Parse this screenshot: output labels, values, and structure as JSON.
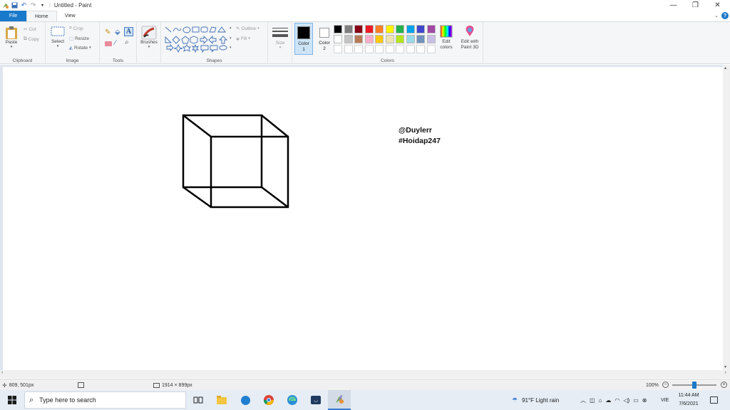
{
  "window": {
    "title": "Untitled - Paint",
    "minimize_glyph": "—",
    "restore_glyph": "❐",
    "close_glyph": "✕"
  },
  "tabs": [
    {
      "label": "File"
    },
    {
      "label": "Home"
    },
    {
      "label": "View"
    }
  ],
  "ribbon": {
    "clipboard": {
      "label": "Clipboard",
      "paste": "Paste",
      "cut": "Cut",
      "copy": "Copy"
    },
    "image": {
      "label": "Image",
      "select": "Select",
      "crop": "Crop",
      "resize": "Resize",
      "rotate": "Rotate"
    },
    "tools": {
      "label": "Tools"
    },
    "brushes": {
      "label": "Brushes"
    },
    "shapes": {
      "label": "Shapes",
      "outline": "Outline",
      "fill": "Fill"
    },
    "size": {
      "label": "Size"
    },
    "colors": {
      "label": "Colors",
      "color1": "Color 1",
      "color2": "Color 2",
      "edit_colors": "Edit colors",
      "edit_paint3d": "Edit with Paint 3D",
      "color1_value": "#000000",
      "color2_value": "#ffffff",
      "palette_row1": [
        "#000000",
        "#7f7f7f",
        "#880015",
        "#ed1c24",
        "#ff7f27",
        "#fff200",
        "#22b14c",
        "#00a2e8",
        "#3f48cc",
        "#a349a4"
      ],
      "palette_row2": [
        "#ffffff",
        "#c3c3c3",
        "#b97a57",
        "#ffaec9",
        "#ffc90e",
        "#efe4b0",
        "#b5e61d",
        "#99d9ea",
        "#7092be",
        "#c8bfe7"
      ],
      "palette_row3": [
        "#ffffff",
        "#ffffff",
        "#ffffff",
        "#ffffff",
        "#ffffff",
        "#ffffff",
        "#ffffff",
        "#ffffff",
        "#ffffff",
        "#ffffff"
      ]
    }
  },
  "canvas": {
    "watermark_line1": "@Duylerr",
    "watermark_line2": "#Hoidap247"
  },
  "statusbar": {
    "cursor_position": "809, 501px",
    "canvas_size": "1914 × 899px",
    "zoom": "100%",
    "zoom_level": 1.0
  },
  "taskbar": {
    "search_placeholder": "Type here to search",
    "weather": "91°F  Light rain",
    "language": "VIE",
    "time": "11:44 AM",
    "date": "7/6/2021"
  }
}
